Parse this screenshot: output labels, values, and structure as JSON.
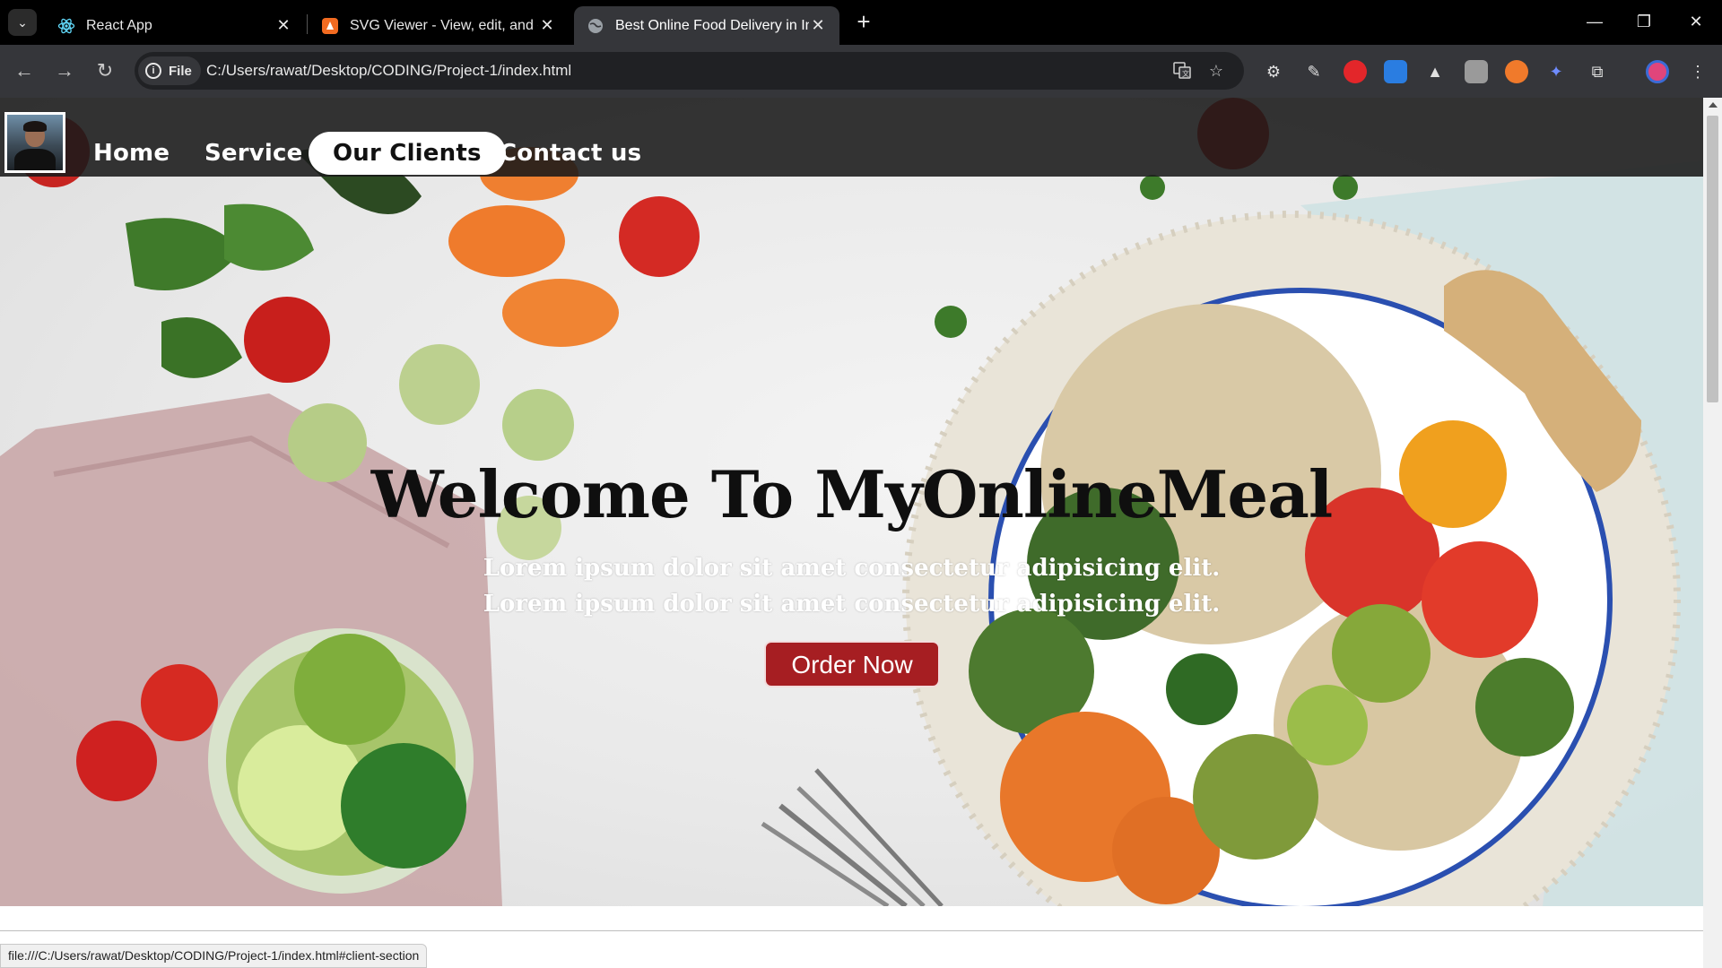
{
  "browser": {
    "tabs": [
      {
        "title": "React App",
        "icon": "react-icon"
      },
      {
        "title": "SVG Viewer - View, edit, and op",
        "icon": "svg-viewer-icon"
      },
      {
        "title": "Best Online Food Delivery in Inc",
        "icon": "globe-icon",
        "active": true
      }
    ],
    "new_tab": "+",
    "chip_label": "File",
    "url": "C:/Users/rawat/Desktop/CODING/Project-1/index.html",
    "status_url": "file:///C:/Users/rawat/Desktop/CODING/Project-1/index.html#client-section"
  },
  "site": {
    "nav": {
      "home": "Home",
      "service": "Service",
      "clients": "Our Clients",
      "contact": "Contact us"
    },
    "hero": {
      "title": "Welcome To MyOnlineMeal",
      "line1": "Lorem ipsum dolor sit amet consectetur adipisicing elit.",
      "line2": "Lorem ipsum dolor sit amet consectetur adipisicing elit.",
      "button": "Order Now"
    }
  },
  "colors": {
    "navbar": "#191919",
    "order_button": "#a61e22",
    "active_nav_bg": "#ffffff"
  }
}
